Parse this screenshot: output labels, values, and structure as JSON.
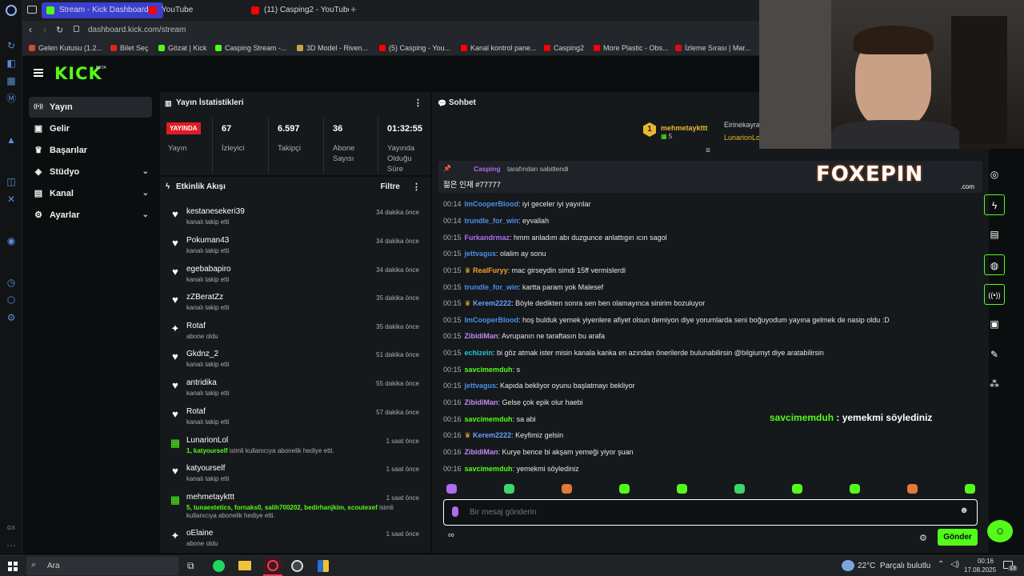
{
  "browser": {
    "tabs": [
      {
        "label": "Stream - Kick Dashboard",
        "color": "#53fc18",
        "active": true
      },
      {
        "label": "YouTube",
        "color": "#ff0000",
        "active": false
      },
      {
        "label": "(11) Casping2 - YouTube",
        "color": "#ff0000",
        "active": false
      }
    ],
    "url": "dashboard.kick.com/stream",
    "bookmarks": [
      {
        "label": "Gelen Kutusu (1.2...",
        "color": "#d44638"
      },
      {
        "label": "Bilet Seç",
        "color": "#e2231a"
      },
      {
        "label": "Gözat | Kick",
        "color": "#53fc18"
      },
      {
        "label": "Casping Stream -...",
        "color": "#53fc18"
      },
      {
        "label": "3D Model - Riven...",
        "color": "#caa24a"
      },
      {
        "label": "(5) Casping - You...",
        "color": "#ff0000"
      },
      {
        "label": "Kanal kontrol pane...",
        "color": "#ff0000"
      },
      {
        "label": "Casping2",
        "color": "#ff0000"
      },
      {
        "label": "More Plastic - Obs...",
        "color": "#ff0000"
      },
      {
        "label": "İzleme Sırası | Mar...",
        "color": "#e30a17"
      }
    ]
  },
  "kick": {
    "logo": "KICK",
    "beta": "BETA",
    "nav": [
      {
        "label": "Yayın",
        "icon": "stream-icon",
        "glyph": "((•))",
        "active": true,
        "chev": false
      },
      {
        "label": "Gelir",
        "icon": "revenue-icon",
        "glyph": "▣",
        "active": false,
        "chev": false
      },
      {
        "label": "Başarılar",
        "icon": "trophy-icon",
        "glyph": "🏆",
        "active": false,
        "chev": false
      },
      {
        "label": "Stüdyo",
        "icon": "studio-icon",
        "glyph": "◈",
        "active": false,
        "chev": true
      },
      {
        "label": "Kanal",
        "icon": "channel-icon",
        "glyph": "▤",
        "active": false,
        "chev": true
      },
      {
        "label": "Ayarlar",
        "icon": "settings-icon",
        "glyph": "⚙",
        "active": false,
        "chev": true
      }
    ]
  },
  "stats": {
    "title": "Yayın İstatistikleri",
    "live_badge": "YAYINDA",
    "live_label": "Yayın",
    "items": [
      {
        "value": "67",
        "label": "İzleyici"
      },
      {
        "value": "6.597",
        "label": "Takipçi"
      },
      {
        "value": "36",
        "label": "Abone Sayısı"
      },
      {
        "value": "01:32:55",
        "label": "Yayında Olduğu Süre"
      }
    ]
  },
  "activity": {
    "title": "Etkinlik Akışı",
    "filter": "Filtre",
    "items": [
      {
        "name": "kestanesekeri39",
        "desc": "kanalı takip etti",
        "time": "34 dakika önce",
        "icon": "heart-icon",
        "glyph": "♥"
      },
      {
        "name": "Pokuman43",
        "desc": "kanalı takip etti",
        "time": "34 dakika önce",
        "icon": "heart-icon",
        "glyph": "♥"
      },
      {
        "name": "egebabapiro",
        "desc": "kanalı takip etti",
        "time": "34 dakika önce",
        "icon": "heart-icon",
        "glyph": "♥"
      },
      {
        "name": "zZBeratZz",
        "desc": "kanalı takip etti",
        "time": "35 dakika önce",
        "icon": "heart-icon",
        "glyph": "♥"
      },
      {
        "name": "Rotaf",
        "desc": "abone oldu",
        "time": "35 dakika önce",
        "icon": "sparkle-icon",
        "glyph": "✦"
      },
      {
        "name": "Gkdnz_2",
        "desc": "kanalı takip etti",
        "time": "51 dakika önce",
        "icon": "heart-icon",
        "glyph": "♥"
      },
      {
        "name": "antridika",
        "desc": "kanalı takip etti",
        "time": "55 dakika önce",
        "icon": "heart-icon",
        "glyph": "♥"
      },
      {
        "name": "Rotaf",
        "desc": "kanalı takip etti",
        "time": "57 dakika önce",
        "icon": "heart-icon",
        "glyph": "♥"
      },
      {
        "name": "LunarionLol",
        "desc_hl": "1, katyourself",
        "desc": " isimli kullanıcıya abonelik hediye etti.",
        "time": "1 saat önce",
        "icon": "gift-icon",
        "glyph": "🎁"
      },
      {
        "name": "katyourself",
        "desc": "kanalı takip etti",
        "time": "1 saat önce",
        "icon": "heart-icon",
        "glyph": "♥"
      },
      {
        "name": "mehmetaykttt",
        "desc_hl": "5, tunaestetics, fornaks0, salih700202, bedirhanjkim, scoutexef",
        "desc": " isimli kullanıcıya abonelik hediye etti.",
        "time": "1 saat önce",
        "icon": "gift-icon",
        "glyph": "🎁"
      },
      {
        "name": "oElaine",
        "desc": "abone oldu",
        "time": "1 saat önce",
        "icon": "sparkle-icon",
        "glyph": "✦"
      }
    ]
  },
  "chat": {
    "title": "Sohbet",
    "gifter_top": {
      "rank": "1",
      "name": "mehmetaykttt",
      "count": "5"
    },
    "gifter_second": {
      "name": "Eirinekayra",
      "name2": "LunarionLo"
    },
    "pinned_by": "Casping",
    "pinned_suffix": "tarafından sabitlendi",
    "pinned_text": "젊은 인재 #77777",
    "messages": [
      {
        "time": "00:14",
        "user": "ImCooperBlood",
        "color": "#4a8fe7",
        "text": ": iyi geceler iyi yayınlar",
        "badge": ""
      },
      {
        "time": "00:14",
        "user": "trundle_for_win",
        "color": "#4a8fe7",
        "text": ": eyvallah",
        "badge": ""
      },
      {
        "time": "00:15",
        "user": "Furkandrmaz",
        "color": "#b06cf0",
        "text": ": hmm anladım abı duzgunce anlattıgın ıcın sagol",
        "badge": ""
      },
      {
        "time": "00:15",
        "user": "jettvagus",
        "color": "#4a8fe7",
        "text": ": olalim ay sonu",
        "badge": ""
      },
      {
        "time": "00:15",
        "user": "RealFuryy",
        "color": "#f0a030",
        "text": ": mac girseydin simdi 15ff vermislerdi",
        "badge": "crown"
      },
      {
        "time": "00:15",
        "user": "trundle_for_win",
        "color": "#4a8fe7",
        "text": ": kartta param yok Malesef",
        "badge": ""
      },
      {
        "time": "00:15",
        "user": "Kerem2222",
        "color": "#6aa0ff",
        "text": ": Böyle dedikten sonra sen ben olamayınca sinirim bozuluyor",
        "badge": "crown"
      },
      {
        "time": "00:15",
        "user": "ImCooperBlood",
        "color": "#4a8fe7",
        "text": ": hoş bulduk yemek yiyenlere afiyet olsun demiyon diye yorumlarda seni boğuyodum yayına gelmek de nasip oldu :D",
        "badge": ""
      },
      {
        "time": "00:15",
        "user": "ZibidiMan",
        "color": "#c08af5",
        "text": ": Avrupanın ne taraftasın bu arafa",
        "badge": ""
      },
      {
        "time": "00:15",
        "user": "echizein",
        "color": "#29c4d6",
        "text": ": bi göz atmak ister misin kanala kanka en azından önerilerde bulunabilirsin @bilgiumyt diye aratabilirsin",
        "badge": ""
      },
      {
        "time": "00:15",
        "user": "savcimemduh",
        "color": "#53fc18",
        "text": ": s",
        "badge": ""
      },
      {
        "time": "00:15",
        "user": "jettvagus",
        "color": "#4a8fe7",
        "text": ": Kapıda bekliyor oyunu başlatmayı bekliyor",
        "badge": ""
      },
      {
        "time": "00:16",
        "user": "ZibidiMan",
        "color": "#c08af5",
        "text": ": Gelse çok epik olur haebi",
        "badge": ""
      },
      {
        "time": "00:16",
        "user": "savcimemduh",
        "color": "#53fc18",
        "text": ": sa abi",
        "badge": ""
      },
      {
        "time": "00:16",
        "user": "Kerem2222",
        "color": "#6aa0ff",
        "text": ": Keyfimiz gelsin",
        "badge": "crown"
      },
      {
        "time": "00:16",
        "user": "ZibidiMan",
        "color": "#c08af5",
        "text": ": Kurye bence bi akşam yemeği yiyor şuan",
        "badge": ""
      },
      {
        "time": "00:16",
        "user": "savcimemduh",
        "color": "#53fc18",
        "text": ": yemekmi söylediniz",
        "badge": ""
      }
    ],
    "overlay_user": "savcimemduh",
    "overlay_text": " : yemekmi söylediniz",
    "input_placeholder": "Bir mesaj gönderin",
    "send_label": "Gönder",
    "emote_count": "10"
  },
  "overlay_brand": {
    "name": "FOXEPIN",
    "suffix": ".com"
  },
  "taskbar": {
    "search": "Ara",
    "weather": "22°C  Parçalı bulutlu",
    "time": "00:16",
    "date": "17.08.2025",
    "notif": "13"
  }
}
